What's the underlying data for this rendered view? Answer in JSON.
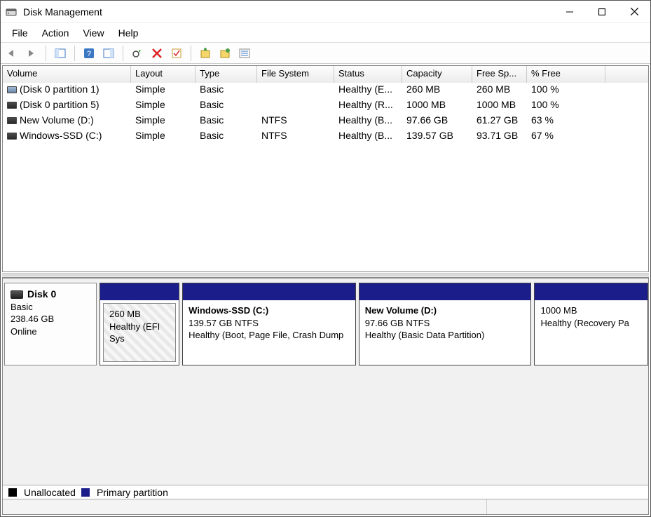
{
  "window": {
    "title": "Disk Management"
  },
  "menu": {
    "file": "File",
    "action": "Action",
    "view": "View",
    "help": "Help"
  },
  "columns": {
    "volume": "Volume",
    "layout": "Layout",
    "type": "Type",
    "filesystem": "File System",
    "status": "Status",
    "capacity": "Capacity",
    "freespace": "Free Sp...",
    "pctfree": "% Free"
  },
  "rows": [
    {
      "icon": "light",
      "volume": "(Disk 0 partition 1)",
      "layout": "Simple",
      "type": "Basic",
      "fs": "",
      "status": "Healthy (E...",
      "cap": "260 MB",
      "free": "260 MB",
      "pct": "100 %"
    },
    {
      "icon": "dark",
      "volume": "(Disk 0 partition 5)",
      "layout": "Simple",
      "type": "Basic",
      "fs": "",
      "status": "Healthy (R...",
      "cap": "1000 MB",
      "free": "1000 MB",
      "pct": "100 %"
    },
    {
      "icon": "dark",
      "volume": "New Volume (D:)",
      "layout": "Simple",
      "type": "Basic",
      "fs": "NTFS",
      "status": "Healthy (B...",
      "cap": "97.66 GB",
      "free": "61.27 GB",
      "pct": "63 %"
    },
    {
      "icon": "dark",
      "volume": "Windows-SSD (C:)",
      "layout": "Simple",
      "type": "Basic",
      "fs": "NTFS",
      "status": "Healthy (B...",
      "cap": "139.57 GB",
      "free": "93.71 GB",
      "pct": "67 %"
    }
  ],
  "disk": {
    "name": "Disk 0",
    "type": "Basic",
    "size": "238.46 GB",
    "state": "Online"
  },
  "parts": {
    "efi": {
      "size": "260 MB",
      "status": "Healthy (EFI Sys"
    },
    "win": {
      "title": "Windows-SSD  (C:)",
      "size": "139.57 GB NTFS",
      "status": "Healthy (Boot, Page File, Crash Dump"
    },
    "new": {
      "title": "New Volume  (D:)",
      "size": "97.66 GB NTFS",
      "status": "Healthy (Basic Data Partition)"
    },
    "rec": {
      "size": "1000 MB",
      "status": "Healthy (Recovery Pa"
    }
  },
  "legend": {
    "unallocated": "Unallocated",
    "primary": "Primary partition"
  }
}
